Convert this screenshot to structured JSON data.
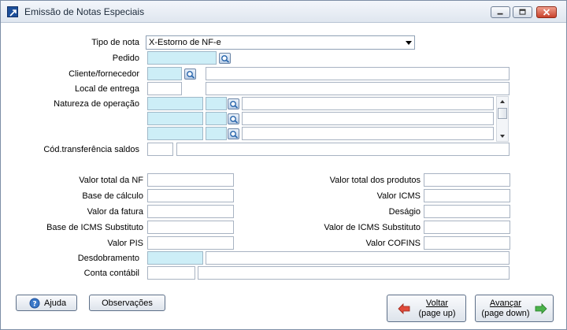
{
  "window": {
    "title": "Emissão de Notas Especiais"
  },
  "form": {
    "tipo_nota": {
      "label": "Tipo de nota",
      "value": "X-Estorno de NF-e"
    },
    "pedido": {
      "label": "Pedido"
    },
    "cliente": {
      "label": "Cliente/fornecedor"
    },
    "local_entrega": {
      "label": "Local de entrega"
    },
    "natureza": {
      "label": "Natureza de operação"
    },
    "cod_transf": {
      "label": "Cód.transferência saldos"
    },
    "valor_total_nf": {
      "label": "Valor total da NF"
    },
    "base_calculo": {
      "label": "Base de cálculo"
    },
    "valor_fatura": {
      "label": "Valor da fatura"
    },
    "base_icms_subst": {
      "label": "Base de ICMS Substituto"
    },
    "valor_pis": {
      "label": "Valor PIS"
    },
    "valor_total_produtos": {
      "label": "Valor total dos produtos"
    },
    "valor_icms": {
      "label": "Valor ICMS"
    },
    "desagio": {
      "label": "Deságio"
    },
    "valor_icms_subst": {
      "label": "Valor de ICMS Substituto"
    },
    "valor_cofins": {
      "label": "Valor COFINS"
    },
    "desdobramento": {
      "label": "Desdobramento"
    },
    "conta_contabil": {
      "label": "Conta contábil"
    }
  },
  "buttons": {
    "ajuda": "Ajuda",
    "observacoes": "Observações",
    "voltar": "Voltar",
    "voltar_sub": "(page up)",
    "avancar": "Avançar",
    "avancar_sub": "(page down)"
  },
  "colors": {
    "required_field": "#cdeef7",
    "accent": "#1d4f9a"
  }
}
